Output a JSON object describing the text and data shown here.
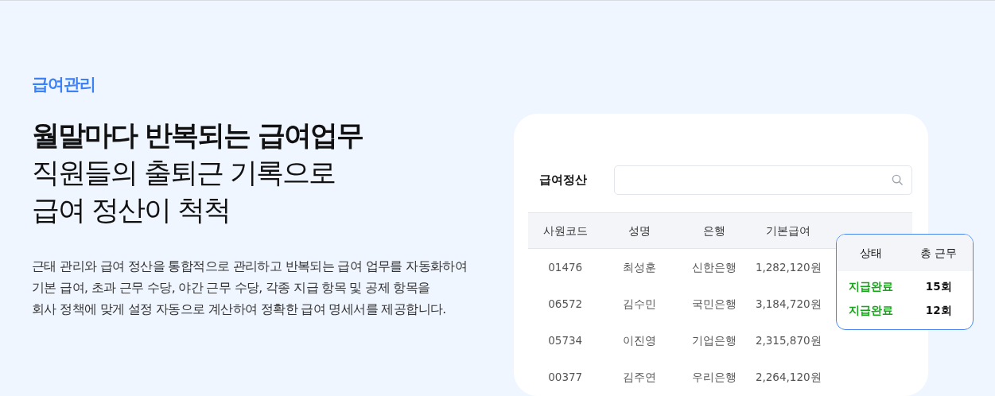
{
  "eyebrow": "급여관리",
  "headline": {
    "bold_line": "월말마다 반복되는 급여업무",
    "lines": [
      "직원들의 출퇴근 기록으로",
      "급여 정산이 척척"
    ]
  },
  "description": [
    "근태 관리와 급여 정산을 통합적으로 관리하고 반복되는 급여 업무를 자동화하여",
    "기본 급여, 초과 근무 수당, 야간 근무 수당, 각종 지급 항목 및 공제 항목을",
    "회사 정책에 맞게 설정 자동으로 계산하여 정확한 급여 명세서를 제공합니다."
  ],
  "panel": {
    "title": "급여정산",
    "table": {
      "columns": [
        "사원코드",
        "성명",
        "은행",
        "기본급여"
      ],
      "rows": [
        [
          "01476",
          "최성훈",
          "신한은행",
          "1,282,120원"
        ],
        [
          "06572",
          "김수민",
          "국민은행",
          "3,184,720원"
        ],
        [
          "05734",
          "이진영",
          "기업은행",
          "2,315,870원"
        ],
        [
          "00377",
          "김주연",
          "우리은행",
          "2,264,120원"
        ]
      ]
    },
    "popup": {
      "columns": [
        "상태",
        "총 근무"
      ],
      "rows": [
        [
          "지급완료",
          "15회"
        ],
        [
          "지급완료",
          "12회"
        ]
      ]
    }
  }
}
